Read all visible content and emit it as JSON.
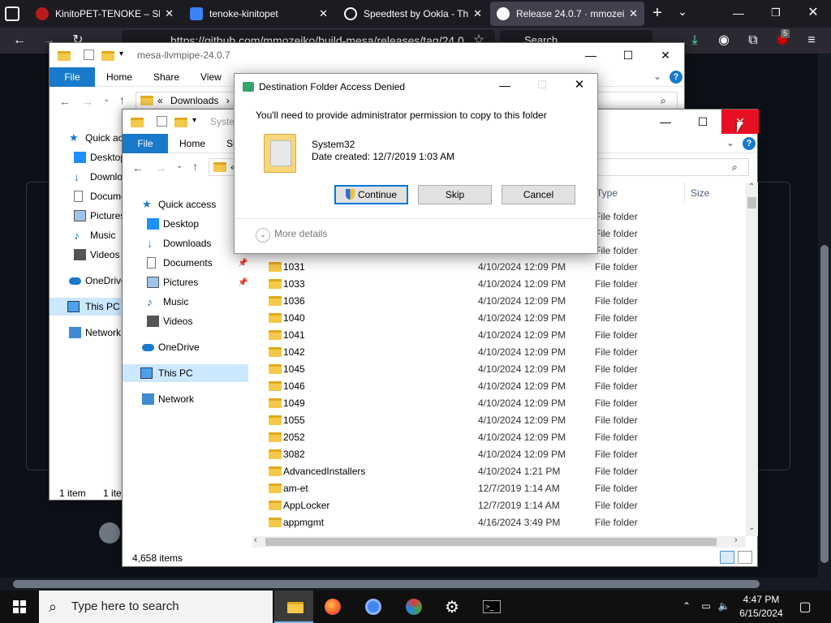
{
  "browser": {
    "tabs": [
      {
        "title": "KinitoPET-TENOKE – Skid",
        "active": false
      },
      {
        "title": "tenoke-kinitopet",
        "active": false
      },
      {
        "title": "Speedtest by Ookla - The",
        "active": false
      },
      {
        "title": "Release 24.0.7 · mmozeiko",
        "active": true
      }
    ],
    "new_tab": "+",
    "url": "https://github.com/mmozeiko/build-mesa/releases/tag/24.0",
    "search_placeholder": "Search",
    "badge_count": "5"
  },
  "back_window": {
    "title": "mesa-llvmpipe-24.0.7",
    "ribbon_tabs": [
      "File",
      "Home",
      "Share",
      "View"
    ],
    "address": "Downloads",
    "address_prefix": "«",
    "nav_items": [
      "Quick access",
      "Desktop",
      "Downloads",
      "Documents",
      "Pictures",
      "Music",
      "Videos",
      "OneDrive",
      "This PC",
      "Network"
    ],
    "status_left": "1 item",
    "status_right": "1 ite"
  },
  "front_window": {
    "title": "System32",
    "ribbon_tabs": [
      "File",
      "Home",
      "Sh"
    ],
    "address_prefix": "«",
    "nav_items": [
      "Quick access",
      "Desktop",
      "Downloads",
      "Documents",
      "Pictures",
      "Music",
      "Videos",
      "OneDrive",
      "This PC",
      "Network"
    ],
    "columns": {
      "type": "Type",
      "size": "Size"
    },
    "partial_types": [
      "File folder",
      "File folder",
      "File folder"
    ],
    "files": [
      {
        "name": "1031",
        "date": "4/10/2024 12:09 PM",
        "type": "File folder"
      },
      {
        "name": "1033",
        "date": "4/10/2024 12:09 PM",
        "type": "File folder"
      },
      {
        "name": "1036",
        "date": "4/10/2024 12:09 PM",
        "type": "File folder"
      },
      {
        "name": "1040",
        "date": "4/10/2024 12:09 PM",
        "type": "File folder"
      },
      {
        "name": "1041",
        "date": "4/10/2024 12:09 PM",
        "type": "File folder"
      },
      {
        "name": "1042",
        "date": "4/10/2024 12:09 PM",
        "type": "File folder"
      },
      {
        "name": "1045",
        "date": "4/10/2024 12:09 PM",
        "type": "File folder"
      },
      {
        "name": "1046",
        "date": "4/10/2024 12:09 PM",
        "type": "File folder"
      },
      {
        "name": "1049",
        "date": "4/10/2024 12:09 PM",
        "type": "File folder"
      },
      {
        "name": "1055",
        "date": "4/10/2024 12:09 PM",
        "type": "File folder"
      },
      {
        "name": "2052",
        "date": "4/10/2024 12:09 PM",
        "type": "File folder"
      },
      {
        "name": "3082",
        "date": "4/10/2024 12:09 PM",
        "type": "File folder"
      },
      {
        "name": "AdvancedInstallers",
        "date": "4/10/2024 1:21 PM",
        "type": "File folder"
      },
      {
        "name": "am-et",
        "date": "12/7/2019 1:14 AM",
        "type": "File folder"
      },
      {
        "name": "AppLocker",
        "date": "12/7/2019 1:14 AM",
        "type": "File folder"
      },
      {
        "name": "appmgmt",
        "date": "4/16/2024 3:49 PM",
        "type": "File folder"
      }
    ],
    "item_count": "4,658 items"
  },
  "dialog": {
    "title": "Destination Folder Access Denied",
    "message": "You'll need to provide administrator permission to copy to this folder",
    "folder_name": "System32",
    "date_created": "Date created: 12/7/2019 1:03 AM",
    "buttons": {
      "continue": "Continue",
      "skip": "Skip",
      "cancel": "Cancel"
    },
    "more_details": "More details"
  },
  "taskbar": {
    "search_placeholder": "Type here to search",
    "time": "4:47 PM",
    "date": "6/15/2024"
  },
  "colors": {
    "accent": "#1979ca",
    "close_red": "#e81123",
    "folder": "#f4c94a"
  }
}
